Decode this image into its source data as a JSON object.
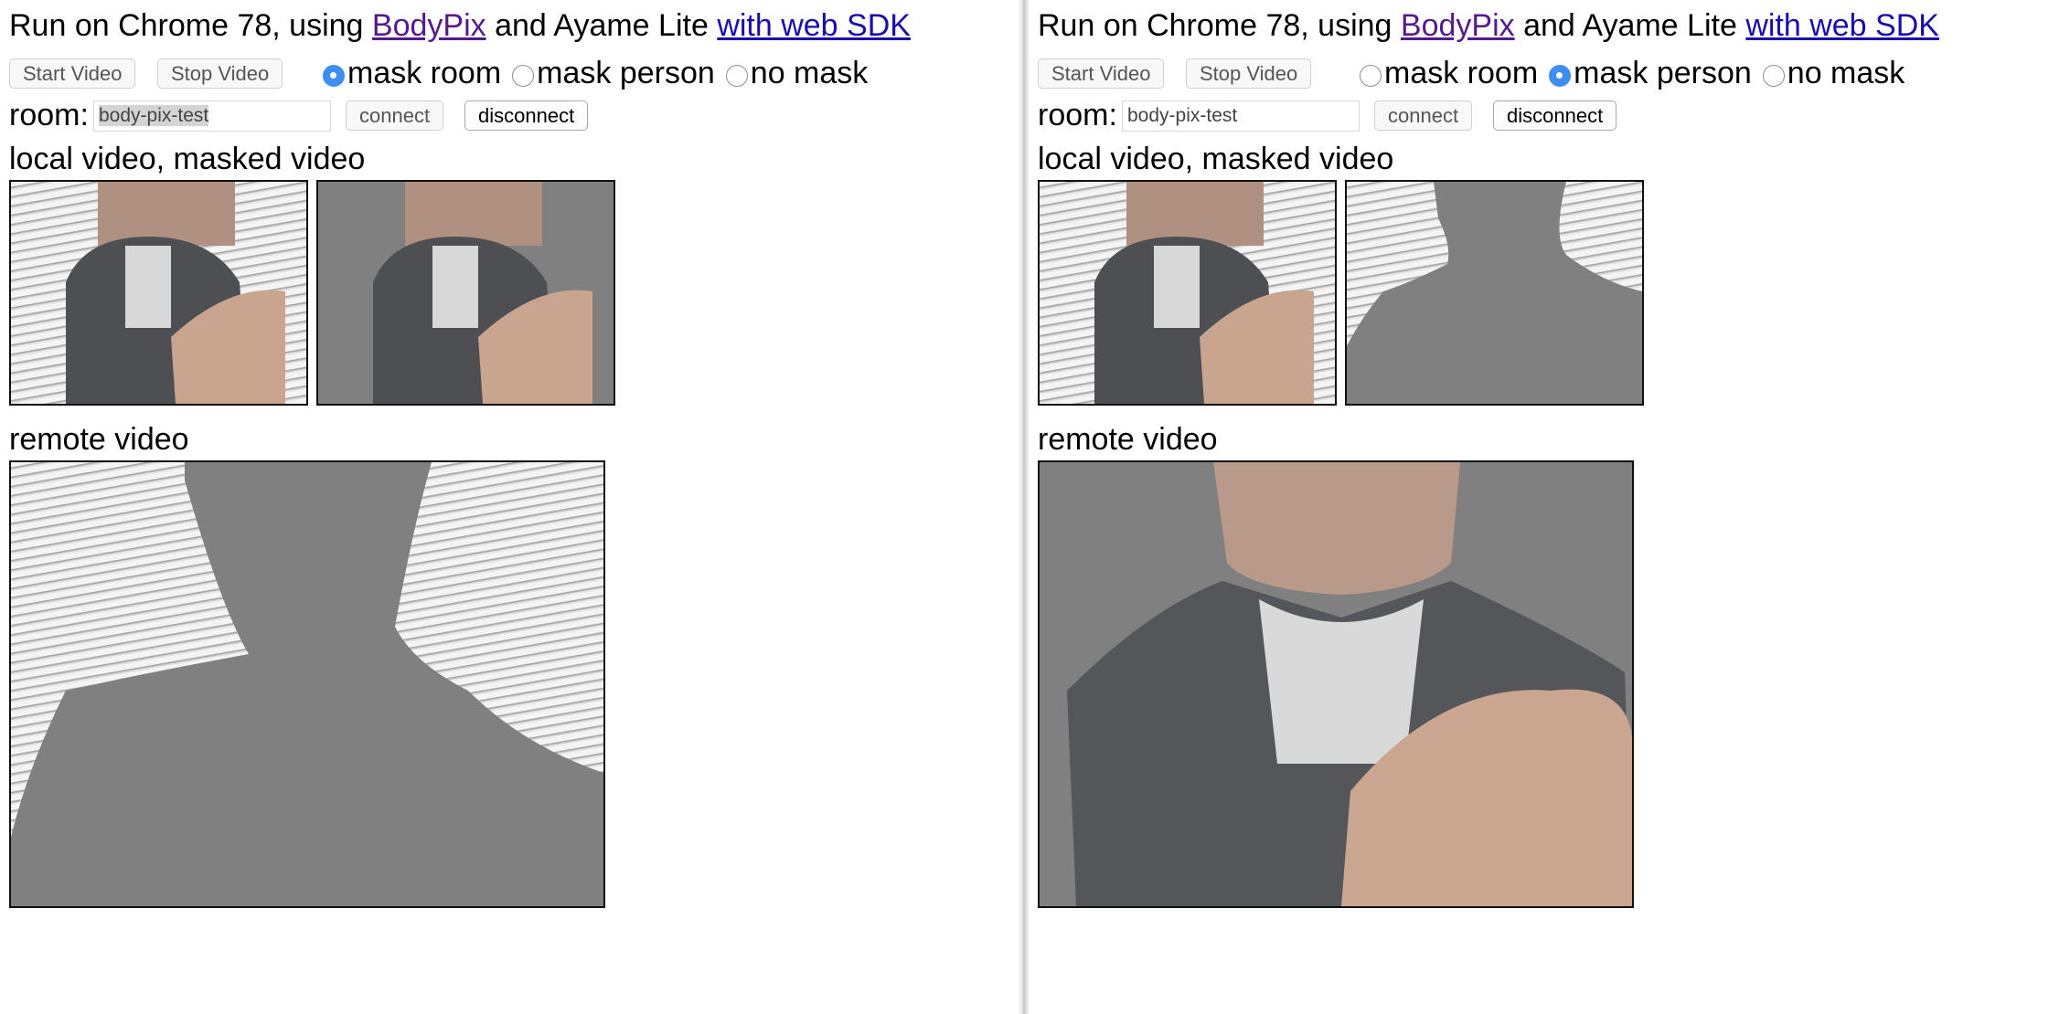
{
  "panes": [
    {
      "title": {
        "prefix": "Run on Chrome 78, using ",
        "link1": "BodyPix",
        "middle": " and Ayame Lite ",
        "link2": "with web SDK"
      },
      "buttons": {
        "start": "Start Video",
        "stop": "Stop Video",
        "connect": "connect",
        "disconnect": "disconnect"
      },
      "mask_options": {
        "mask_room": "mask room",
        "mask_person": "mask person",
        "no_mask": "no mask",
        "selected": "mask room"
      },
      "room": {
        "label": "room:",
        "value": "body-pix-test"
      },
      "local_label": "local video, masked video",
      "remote_label": "remote video"
    },
    {
      "title": {
        "prefix": "Run on Chrome 78, using ",
        "link1": "BodyPix",
        "middle": " and Ayame Lite ",
        "link2": "with web SDK"
      },
      "buttons": {
        "start": "Start Video",
        "stop": "Stop Video",
        "connect": "connect",
        "disconnect": "disconnect"
      },
      "mask_options": {
        "mask_room": "mask room",
        "mask_person": "mask person",
        "no_mask": "no mask",
        "selected": "mask person"
      },
      "room": {
        "label": "room:",
        "value": "body-pix-test"
      },
      "local_label": "local video, masked video",
      "remote_label": "remote video"
    }
  ],
  "colors": {
    "link": "#1a0dab",
    "visited_link": "#551a8b",
    "radio_checked": "#3d8ef0",
    "mask_gray": "#808080"
  }
}
